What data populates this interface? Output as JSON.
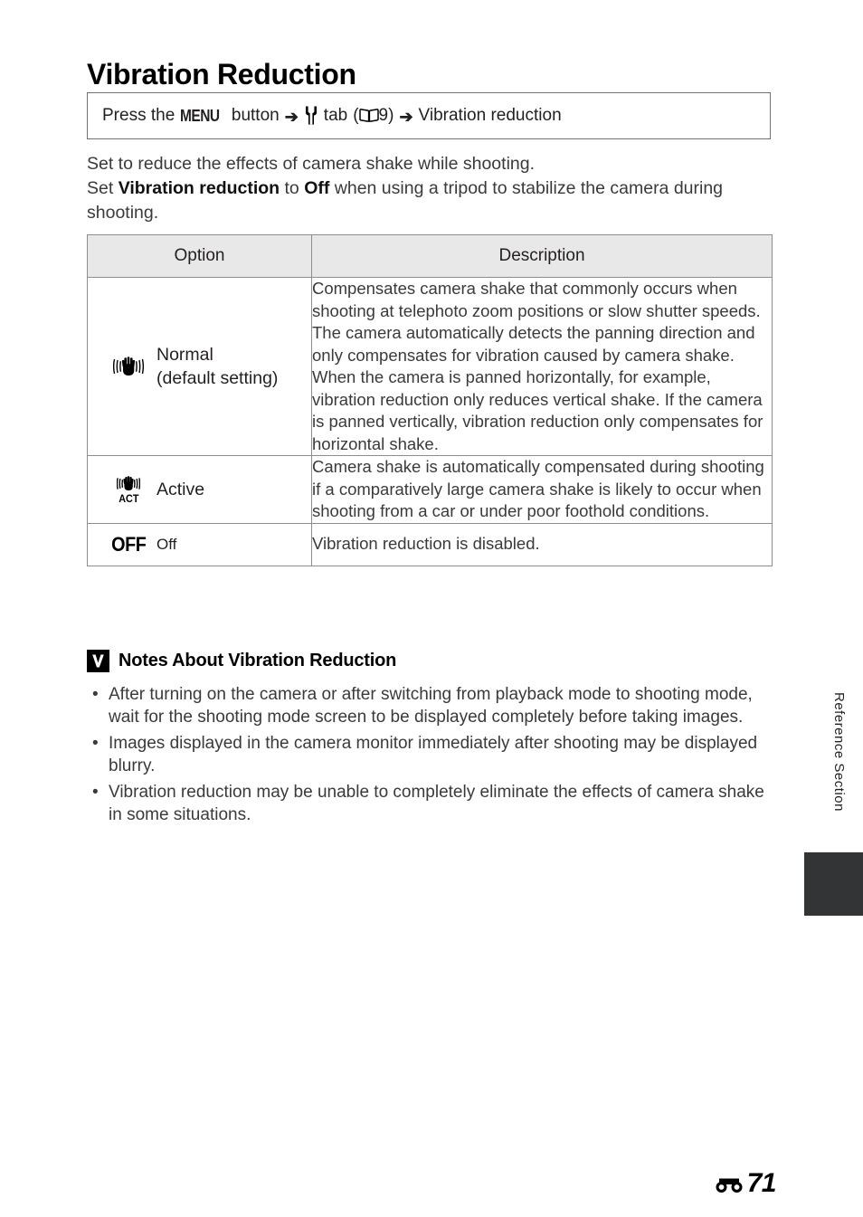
{
  "page": {
    "title": "Vibration Reduction",
    "side_label": "Reference Section",
    "page_number": "71",
    "page_prefix_icon": "e-reference-icon"
  },
  "menu_path": {
    "press_the": "Press the",
    "menu_button_label": "MENU",
    "button_word": "button",
    "arrow1": "➔",
    "setup_tab_icon": "wrench-setup-tab-icon",
    "tab_word": "tab",
    "open_paren": "(",
    "book_icon": "book-reference-icon",
    "ref_page": "9)",
    "arrow2": "➔",
    "destination": "Vibration reduction"
  },
  "intro": {
    "line1": "Set to reduce the effects of camera shake while shooting.",
    "line2_prefix": "Set ",
    "line2_bold1": "Vibration reduction",
    "line2_mid": " to ",
    "line2_bold2": "Off",
    "line2_suffix": " when using a tripod to stabilize the camera during shooting."
  },
  "table": {
    "headers": {
      "option": "Option",
      "description": "Description"
    },
    "rows": [
      {
        "icon": "vr-hand-normal-icon",
        "label_line1": "Normal",
        "label_line2": "(default setting)",
        "description": "Compensates camera shake that commonly occurs when shooting at telephoto zoom positions or slow shutter speeds. The camera automatically detects the panning direction and only compensates for vibration caused by camera shake.\nWhen the camera is panned horizontally, for example, vibration reduction only reduces vertical shake. If the camera is panned vertically, vibration reduction only compensates for horizontal shake."
      },
      {
        "icon": "vr-hand-active-icon",
        "icon_text": "ACT",
        "label_line1": "Active",
        "label_line2": "",
        "description": "Camera shake is automatically compensated during shooting if a comparatively large camera shake is likely to occur when shooting from a car or under poor foothold conditions."
      },
      {
        "icon": "off-text-icon",
        "icon_text": "OFF",
        "label_line1": "Off",
        "label_line2": "",
        "description": "Vibration reduction is disabled."
      }
    ]
  },
  "notes": {
    "badge_icon": "checkmark-note-icon",
    "title": "Notes About Vibration Reduction",
    "bullet": "•",
    "items": [
      "After turning on the camera or after switching from playback mode to shooting mode, wait for the shooting mode screen to be displayed completely before taking images.",
      "Images displayed in the camera monitor immediately after shooting may be displayed blurry.",
      "Vibration reduction may be unable to completely eliminate the effects of camera shake in some situations."
    ]
  },
  "colors": {
    "text": "#3a3a3a",
    "heading": "#000000",
    "table_border": "#8b8d8f",
    "header_fill": "#e8e8e8",
    "side_tab": "#333436"
  }
}
